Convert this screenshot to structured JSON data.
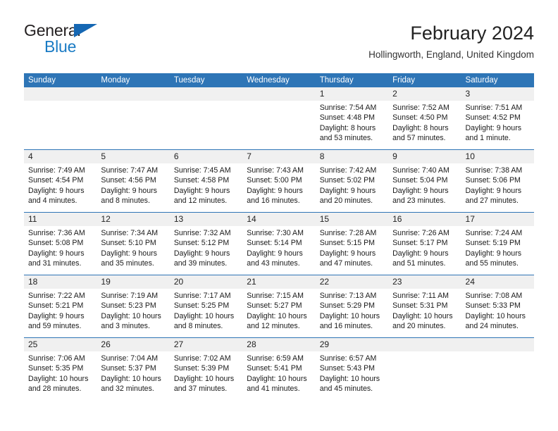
{
  "brand": {
    "name_top": "General",
    "name_bottom": "Blue",
    "triangle_color": "#1567b3",
    "bottom_color": "#1a7bc4"
  },
  "header": {
    "title": "February 2024",
    "subtitle": "Hollingworth, England, United Kingdom"
  },
  "theme": {
    "header_bg": "#2e75b6",
    "header_text": "#ffffff",
    "daynum_bg": "#f0f0f0",
    "cell_bg": "#ffffff",
    "rule_color": "#2e75b6",
    "body_text": "#1a1a1a"
  },
  "weekdays": [
    "Sunday",
    "Monday",
    "Tuesday",
    "Wednesday",
    "Thursday",
    "Friday",
    "Saturday"
  ],
  "weeks": [
    {
      "days": [
        {
          "number": "",
          "lines": [
            "",
            "",
            "",
            ""
          ]
        },
        {
          "number": "",
          "lines": [
            "",
            "",
            "",
            ""
          ]
        },
        {
          "number": "",
          "lines": [
            "",
            "",
            "",
            ""
          ]
        },
        {
          "number": "",
          "lines": [
            "",
            "",
            "",
            ""
          ]
        },
        {
          "number": "1",
          "lines": [
            "Sunrise: 7:54 AM",
            "Sunset: 4:48 PM",
            "Daylight: 8 hours",
            "and 53 minutes."
          ]
        },
        {
          "number": "2",
          "lines": [
            "Sunrise: 7:52 AM",
            "Sunset: 4:50 PM",
            "Daylight: 8 hours",
            "and 57 minutes."
          ]
        },
        {
          "number": "3",
          "lines": [
            "Sunrise: 7:51 AM",
            "Sunset: 4:52 PM",
            "Daylight: 9 hours",
            "and 1 minute."
          ]
        }
      ]
    },
    {
      "days": [
        {
          "number": "4",
          "lines": [
            "Sunrise: 7:49 AM",
            "Sunset: 4:54 PM",
            "Daylight: 9 hours",
            "and 4 minutes."
          ]
        },
        {
          "number": "5",
          "lines": [
            "Sunrise: 7:47 AM",
            "Sunset: 4:56 PM",
            "Daylight: 9 hours",
            "and 8 minutes."
          ]
        },
        {
          "number": "6",
          "lines": [
            "Sunrise: 7:45 AM",
            "Sunset: 4:58 PM",
            "Daylight: 9 hours",
            "and 12 minutes."
          ]
        },
        {
          "number": "7",
          "lines": [
            "Sunrise: 7:43 AM",
            "Sunset: 5:00 PM",
            "Daylight: 9 hours",
            "and 16 minutes."
          ]
        },
        {
          "number": "8",
          "lines": [
            "Sunrise: 7:42 AM",
            "Sunset: 5:02 PM",
            "Daylight: 9 hours",
            "and 20 minutes."
          ]
        },
        {
          "number": "9",
          "lines": [
            "Sunrise: 7:40 AM",
            "Sunset: 5:04 PM",
            "Daylight: 9 hours",
            "and 23 minutes."
          ]
        },
        {
          "number": "10",
          "lines": [
            "Sunrise: 7:38 AM",
            "Sunset: 5:06 PM",
            "Daylight: 9 hours",
            "and 27 minutes."
          ]
        }
      ]
    },
    {
      "days": [
        {
          "number": "11",
          "lines": [
            "Sunrise: 7:36 AM",
            "Sunset: 5:08 PM",
            "Daylight: 9 hours",
            "and 31 minutes."
          ]
        },
        {
          "number": "12",
          "lines": [
            "Sunrise: 7:34 AM",
            "Sunset: 5:10 PM",
            "Daylight: 9 hours",
            "and 35 minutes."
          ]
        },
        {
          "number": "13",
          "lines": [
            "Sunrise: 7:32 AM",
            "Sunset: 5:12 PM",
            "Daylight: 9 hours",
            "and 39 minutes."
          ]
        },
        {
          "number": "14",
          "lines": [
            "Sunrise: 7:30 AM",
            "Sunset: 5:14 PM",
            "Daylight: 9 hours",
            "and 43 minutes."
          ]
        },
        {
          "number": "15",
          "lines": [
            "Sunrise: 7:28 AM",
            "Sunset: 5:15 PM",
            "Daylight: 9 hours",
            "and 47 minutes."
          ]
        },
        {
          "number": "16",
          "lines": [
            "Sunrise: 7:26 AM",
            "Sunset: 5:17 PM",
            "Daylight: 9 hours",
            "and 51 minutes."
          ]
        },
        {
          "number": "17",
          "lines": [
            "Sunrise: 7:24 AM",
            "Sunset: 5:19 PM",
            "Daylight: 9 hours",
            "and 55 minutes."
          ]
        }
      ]
    },
    {
      "days": [
        {
          "number": "18",
          "lines": [
            "Sunrise: 7:22 AM",
            "Sunset: 5:21 PM",
            "Daylight: 9 hours",
            "and 59 minutes."
          ]
        },
        {
          "number": "19",
          "lines": [
            "Sunrise: 7:19 AM",
            "Sunset: 5:23 PM",
            "Daylight: 10 hours",
            "and 3 minutes."
          ]
        },
        {
          "number": "20",
          "lines": [
            "Sunrise: 7:17 AM",
            "Sunset: 5:25 PM",
            "Daylight: 10 hours",
            "and 8 minutes."
          ]
        },
        {
          "number": "21",
          "lines": [
            "Sunrise: 7:15 AM",
            "Sunset: 5:27 PM",
            "Daylight: 10 hours",
            "and 12 minutes."
          ]
        },
        {
          "number": "22",
          "lines": [
            "Sunrise: 7:13 AM",
            "Sunset: 5:29 PM",
            "Daylight: 10 hours",
            "and 16 minutes."
          ]
        },
        {
          "number": "23",
          "lines": [
            "Sunrise: 7:11 AM",
            "Sunset: 5:31 PM",
            "Daylight: 10 hours",
            "and 20 minutes."
          ]
        },
        {
          "number": "24",
          "lines": [
            "Sunrise: 7:08 AM",
            "Sunset: 5:33 PM",
            "Daylight: 10 hours",
            "and 24 minutes."
          ]
        }
      ]
    },
    {
      "days": [
        {
          "number": "25",
          "lines": [
            "Sunrise: 7:06 AM",
            "Sunset: 5:35 PM",
            "Daylight: 10 hours",
            "and 28 minutes."
          ]
        },
        {
          "number": "26",
          "lines": [
            "Sunrise: 7:04 AM",
            "Sunset: 5:37 PM",
            "Daylight: 10 hours",
            "and 32 minutes."
          ]
        },
        {
          "number": "27",
          "lines": [
            "Sunrise: 7:02 AM",
            "Sunset: 5:39 PM",
            "Daylight: 10 hours",
            "and 37 minutes."
          ]
        },
        {
          "number": "28",
          "lines": [
            "Sunrise: 6:59 AM",
            "Sunset: 5:41 PM",
            "Daylight: 10 hours",
            "and 41 minutes."
          ]
        },
        {
          "number": "29",
          "lines": [
            "Sunrise: 6:57 AM",
            "Sunset: 5:43 PM",
            "Daylight: 10 hours",
            "and 45 minutes."
          ]
        },
        {
          "number": "",
          "lines": [
            "",
            "",
            "",
            ""
          ]
        },
        {
          "number": "",
          "lines": [
            "",
            "",
            "",
            ""
          ]
        }
      ]
    }
  ]
}
